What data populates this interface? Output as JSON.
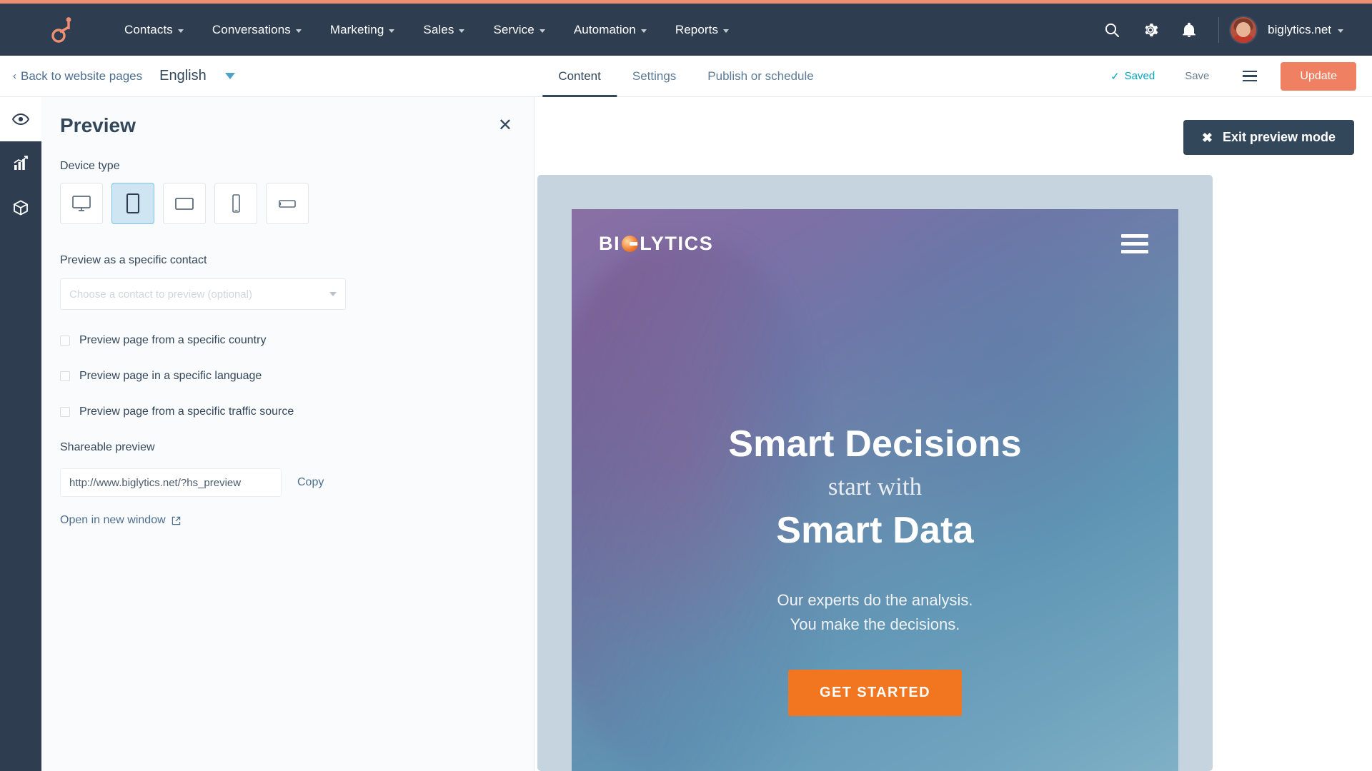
{
  "navbar": {
    "logo_icon": "hubspot-sprocket-logo",
    "items": [
      {
        "label": "Contacts"
      },
      {
        "label": "Conversations"
      },
      {
        "label": "Marketing"
      },
      {
        "label": "Sales"
      },
      {
        "label": "Service"
      },
      {
        "label": "Automation"
      },
      {
        "label": "Reports"
      }
    ],
    "search_icon": "search-icon",
    "settings_icon": "gear-icon",
    "notifications_icon": "bell-icon",
    "avatar_icon": "user-avatar",
    "account_name": "biglytics.net"
  },
  "toolbar": {
    "back_label": "Back to website pages",
    "back_chevron": "‹",
    "language": "English",
    "tabs": [
      {
        "label": "Content",
        "active": true
      },
      {
        "label": "Settings",
        "active": false
      },
      {
        "label": "Publish or schedule",
        "active": false
      }
    ],
    "saved_status": "Saved",
    "saved_check": "✓",
    "save_label": "Save",
    "menu_icon": "hamburger-menu-icon",
    "update_label": "Update"
  },
  "rail": {
    "items": [
      {
        "icon": "eye-icon",
        "active": true
      },
      {
        "icon": "bar-chart-icon",
        "active": false
      },
      {
        "icon": "cube-icon",
        "active": false
      }
    ]
  },
  "panel": {
    "title": "Preview",
    "close_icon": "close-icon",
    "close_glyph": "✕",
    "device_type_label": "Device type",
    "devices": [
      {
        "icon": "desktop-monitor-icon",
        "selected": false
      },
      {
        "icon": "tablet-portrait-icon",
        "selected": true
      },
      {
        "icon": "tablet-landscape-icon",
        "selected": false
      },
      {
        "icon": "phone-portrait-icon",
        "selected": false
      },
      {
        "icon": "phone-landscape-icon",
        "selected": false
      }
    ],
    "contact_label": "Preview as a specific contact",
    "contact_placeholder": "Choose a contact to preview (optional)",
    "checkboxes": [
      {
        "label": "Preview page from a specific country",
        "checked": false
      },
      {
        "label": "Preview page in a specific language",
        "checked": false
      },
      {
        "label": "Preview page from a specific traffic source",
        "checked": false
      }
    ],
    "shareable_label": "Shareable preview",
    "shareable_url": "http://www.biglytics.net/?hs_preview",
    "copy_label": "Copy",
    "open_label": "Open in new window",
    "open_icon": "external-link-icon"
  },
  "exit_preview": {
    "label": "Exit preview mode",
    "icon": "close-icon",
    "glyph": "✖"
  },
  "preview_page": {
    "logo_text_before": "BI",
    "logo_text_after": "LYTICS",
    "logo_icon": "biglytics-orange-g-icon",
    "menu_icon": "hamburger-menu-icon",
    "headline_1": "Smart Decisions",
    "headline_script": "start with",
    "headline_2": "Smart Data",
    "sub_line_1": "Our experts do the analysis.",
    "sub_line_2": "You make the decisions.",
    "cta_label": "GET STARTED"
  },
  "colors": {
    "brand_orange": "#ef8062",
    "navy": "#2e3e50",
    "teal": "#00a4bd",
    "link_blue": "#4d6e8f",
    "cta_orange": "#f2751f",
    "selected_device": "#cfe6f2"
  }
}
